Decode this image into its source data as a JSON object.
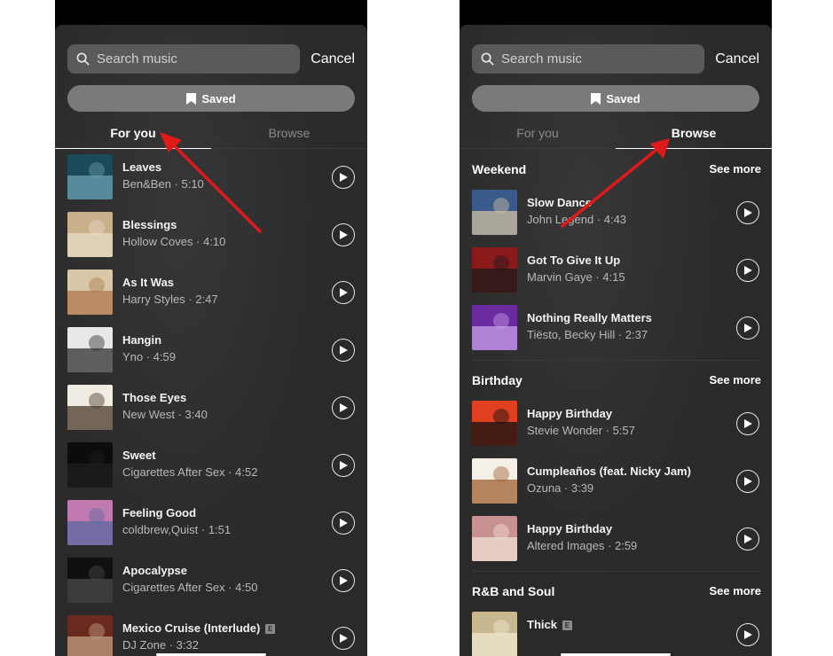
{
  "left": {
    "search_placeholder": "Search music",
    "cancel_label": "Cancel",
    "saved_label": "Saved",
    "tabs": [
      {
        "label": "For you",
        "active": true
      },
      {
        "label": "Browse",
        "active": false
      }
    ],
    "tracks": [
      {
        "title": "Leaves",
        "subtitle": "Ben&Ben · 5:10",
        "explicit": false,
        "colors": [
          "#1d4a5a",
          "#6aa0b0"
        ]
      },
      {
        "title": "Blessings",
        "subtitle": "Hollow Coves · 4:10",
        "explicit": false,
        "colors": [
          "#c8b08a",
          "#e8dcc4"
        ]
      },
      {
        "title": "As It Was",
        "subtitle": "Harry Styles · 2:47",
        "explicit": false,
        "colors": [
          "#d8c8a8",
          "#b07850"
        ]
      },
      {
        "title": "Hangin",
        "subtitle": "Yno · 4:59",
        "explicit": false,
        "colors": [
          "#e8e8e8",
          "#303030"
        ]
      },
      {
        "title": "Those Eyes",
        "subtitle": "New West · 3:40",
        "explicit": false,
        "colors": [
          "#f0ece4",
          "#4a3a2a"
        ]
      },
      {
        "title": "Sweet",
        "subtitle": "Cigarettes After Sex · 4:52",
        "explicit": false,
        "colors": [
          "#0c0c0c",
          "#1e1e1e"
        ]
      },
      {
        "title": "Feeling Good",
        "subtitle": "coldbrew,Quist · 1:51",
        "explicit": false,
        "colors": [
          "#c07ab0",
          "#5a6aa0"
        ]
      },
      {
        "title": "Apocalypse",
        "subtitle": "Cigarettes After Sex · 4:50",
        "explicit": false,
        "colors": [
          "#101010",
          "#4a4a4a"
        ]
      },
      {
        "title": "Mexico Cruise (Interlude)",
        "subtitle": "DJ Zone · 3:32",
        "explicit": true,
        "explicit_label": "E",
        "colors": [
          "#6a2a20",
          "#c0a080"
        ]
      }
    ]
  },
  "right": {
    "search_placeholder": "Search music",
    "cancel_label": "Cancel",
    "saved_label": "Saved",
    "tabs": [
      {
        "label": "For you",
        "active": false
      },
      {
        "label": "Browse",
        "active": true
      }
    ],
    "sections": [
      {
        "title": "Weekend",
        "see_more": "See more",
        "tracks": [
          {
            "title": "Slow Dance",
            "subtitle": "John Legend · 4:43",
            "explicit": false,
            "colors": [
              "#3a5a8a",
              "#d0c0a0"
            ]
          },
          {
            "title": "Got To Give It Up",
            "subtitle": "Marvin Gaye · 4:15",
            "explicit": false,
            "colors": [
              "#8a1a1a",
              "#1a1a1a"
            ]
          },
          {
            "title": "Nothing Really Matters",
            "subtitle": "Tiësto, Becky Hill · 2:37",
            "explicit": false,
            "colors": [
              "#6a2aa0",
              "#c8a0e8"
            ]
          }
        ]
      },
      {
        "title": "Birthday",
        "see_more": "See more",
        "tracks": [
          {
            "title": "Happy Birthday",
            "subtitle": "Stevie Wonder · 5:57",
            "explicit": false,
            "colors": [
              "#e04020",
              "#101010"
            ]
          },
          {
            "title": "Cumpleaños (feat. Nicky Jam)",
            "subtitle": "Ozuna · 3:39",
            "explicit": false,
            "colors": [
              "#f4f0e8",
              "#a06030"
            ]
          },
          {
            "title": "Happy Birthday",
            "subtitle": "Altered Images · 2:59",
            "explicit": false,
            "colors": [
              "#c89090",
              "#f0e0d0"
            ]
          }
        ]
      },
      {
        "title": "R&B and Soul",
        "see_more": "See more",
        "tracks": [
          {
            "title": "Thick",
            "subtitle": "",
            "explicit": true,
            "explicit_label": "E",
            "colors": [
              "#c8b890",
              "#f0e8d0"
            ]
          }
        ]
      }
    ]
  },
  "accent_arrow_color": "#e0191b"
}
